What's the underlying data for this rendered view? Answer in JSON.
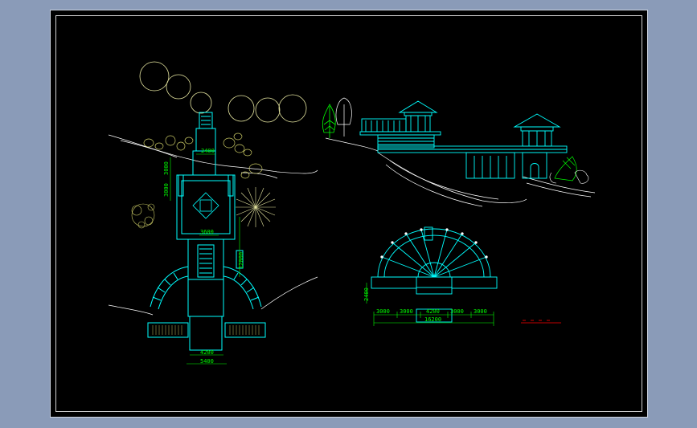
{
  "drawing": {
    "plan_dimensions": {
      "top_width": "2400",
      "side_a": "3000",
      "side_b": "3000",
      "mid_width": "3600",
      "side_c": "12000",
      "bottom_inner": "4200",
      "bottom_outer": "5400"
    },
    "arc_plan_dimensions": {
      "height": "2400",
      "seg1": "3000",
      "seg2": "3000",
      "center": "4200",
      "seg4": "3000",
      "seg5": "3000",
      "total": "16200"
    },
    "colors": {
      "background": "#000000",
      "outer_bg": "#8a9bb8",
      "structure": "#00ffff",
      "dimension": "#00ff00",
      "vegetation": "#c8c864",
      "white_line": "#ffffff",
      "title_red": "#ff0000"
    }
  }
}
